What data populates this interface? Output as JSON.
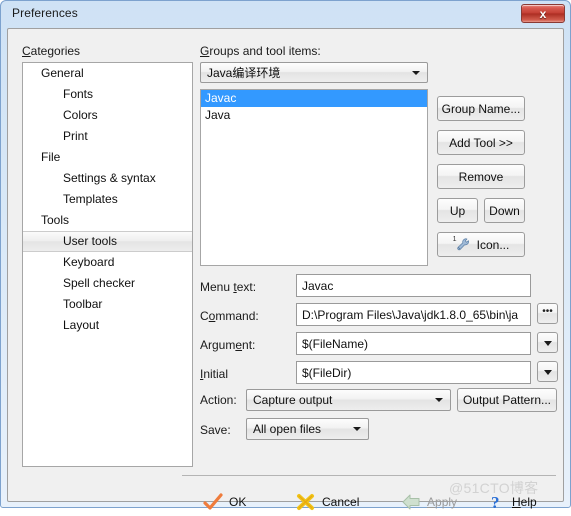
{
  "window": {
    "title": "Preferences",
    "close_label": "x"
  },
  "categories": {
    "label": "Categories",
    "items": [
      {
        "label": "General",
        "level": 0,
        "selected": false
      },
      {
        "label": "Fonts",
        "level": 1,
        "selected": false
      },
      {
        "label": "Colors",
        "level": 1,
        "selected": false
      },
      {
        "label": "Print",
        "level": 1,
        "selected": false
      },
      {
        "label": "File",
        "level": 0,
        "selected": false
      },
      {
        "label": "Settings & syntax",
        "level": 1,
        "selected": false
      },
      {
        "label": "Templates",
        "level": 1,
        "selected": false
      },
      {
        "label": "Tools",
        "level": 0,
        "selected": false
      },
      {
        "label": "User tools",
        "level": 1,
        "selected": true
      },
      {
        "label": "Keyboard",
        "level": 1,
        "selected": false
      },
      {
        "label": "Spell checker",
        "level": 1,
        "selected": false
      },
      {
        "label": "Toolbar",
        "level": 1,
        "selected": false
      },
      {
        "label": "Layout",
        "level": 1,
        "selected": false
      }
    ]
  },
  "groups": {
    "label": "Groups and tool items:",
    "selected_group": "Java编译环境",
    "tools": [
      {
        "label": "Javac",
        "selected": true
      },
      {
        "label": "Java",
        "selected": false
      }
    ],
    "buttons": {
      "group_name": "Group Name...",
      "add_tool": "Add Tool >>",
      "remove": "Remove",
      "up": "Up",
      "down": "Down",
      "icon": "Icon...",
      "icon_superscript": "1"
    }
  },
  "form": {
    "menu_text": {
      "label": "Menu text:",
      "value": "Javac"
    },
    "command": {
      "label": "Command:",
      "value": "D:\\Program Files\\Java\\jdk1.8.0_65\\bin\\ja",
      "browse_label": "•••"
    },
    "argument": {
      "label": "Argument:",
      "value": "$(FileName)"
    },
    "initial": {
      "label": "Initial",
      "value": "$(FileDir)"
    },
    "action": {
      "label": "Action:",
      "value": "Capture output",
      "pattern_button": "Output Pattern..."
    },
    "save": {
      "label": "Save:",
      "value": "All open files"
    }
  },
  "bottom_bar": {
    "ok": "OK",
    "cancel": "Cancel",
    "apply": "Apply",
    "help": "Help"
  },
  "watermark": "@51CTO博客",
  "colors": {
    "selection_blue": "#3399ff",
    "titlebar_blue": "#cfe2f5",
    "close_red": "#c23d32",
    "ok_check_orange": "#ef7c3c",
    "cancel_x_yellow": "#f0c419",
    "apply_arrow_gray": "#b9cdb9",
    "help_question_blue": "#2a6fd6",
    "watermark_gray": "#d2d2d2"
  }
}
